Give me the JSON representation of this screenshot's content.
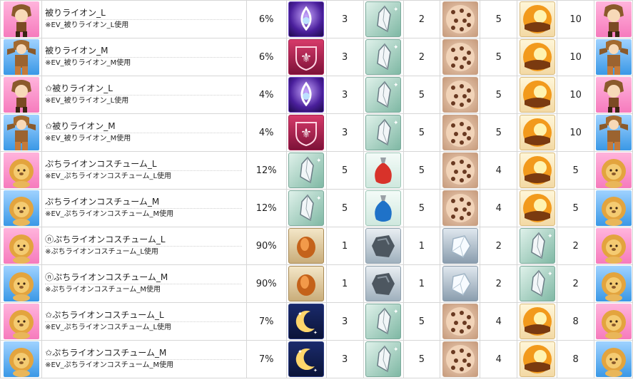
{
  "rows": [
    {
      "name": "被りライオン_L",
      "sub": "※EV_被りライオン_L使用",
      "rate": "6%",
      "avatar": "lion-hood-pink",
      "items": [
        {
          "icon": "purple-drop-orb-icon",
          "qty": "3"
        },
        {
          "icon": "crystal-shard-icon",
          "qty": "2"
        },
        {
          "icon": "leopard-pattern-icon",
          "qty": "5"
        },
        {
          "icon": "sunset-orb-icon",
          "qty": "10"
        }
      ]
    },
    {
      "name": "被りライオン_M",
      "sub": "※EV_被りライオン_M使用",
      "rate": "6%",
      "avatar": "lion-hood-blue",
      "items": [
        {
          "icon": "fleur-de-lis-shield-icon",
          "qty": "3"
        },
        {
          "icon": "crystal-shard-icon",
          "qty": "2"
        },
        {
          "icon": "leopard-pattern-icon",
          "qty": "5"
        },
        {
          "icon": "sunset-orb-icon",
          "qty": "10"
        }
      ]
    },
    {
      "name": "✩被りライオン_L",
      "sub": "※EV_被りライオン_L使用",
      "rate": "4%",
      "avatar": "lion-hood-pink",
      "items": [
        {
          "icon": "purple-drop-orb-icon",
          "qty": "3"
        },
        {
          "icon": "crystal-shard-icon",
          "qty": "5"
        },
        {
          "icon": "leopard-pattern-icon",
          "qty": "5"
        },
        {
          "icon": "sunset-orb-icon",
          "qty": "10"
        }
      ]
    },
    {
      "name": "✩被りライオン_M",
      "sub": "※EV_被りライオン_M使用",
      "rate": "4%",
      "avatar": "lion-hood-blue",
      "items": [
        {
          "icon": "fleur-de-lis-shield-icon",
          "qty": "3"
        },
        {
          "icon": "crystal-shard-icon",
          "qty": "5"
        },
        {
          "icon": "leopard-pattern-icon",
          "qty": "5"
        },
        {
          "icon": "sunset-orb-icon",
          "qty": "10"
        }
      ]
    },
    {
      "name": "ぷちライオンコスチューム_L",
      "sub": "※EV_ぷちライオンコスチューム_L使用",
      "rate": "12%",
      "avatar": "petit-lion-pink",
      "items": [
        {
          "icon": "crystal-shard-icon",
          "qty": "5"
        },
        {
          "icon": "red-pouch-icon",
          "qty": "5"
        },
        {
          "icon": "leopard-pattern-icon",
          "qty": "4"
        },
        {
          "icon": "sunset-orb-icon",
          "qty": "5"
        }
      ]
    },
    {
      "name": "ぷちライオンコスチューム_M",
      "sub": "※EV_ぷちライオンコスチューム_M使用",
      "rate": "12%",
      "avatar": "petit-lion-blue",
      "items": [
        {
          "icon": "crystal-shard-icon",
          "qty": "5"
        },
        {
          "icon": "blue-pouch-icon",
          "qty": "5"
        },
        {
          "icon": "leopard-pattern-icon",
          "qty": "4"
        },
        {
          "icon": "sunset-orb-icon",
          "qty": "5"
        }
      ]
    },
    {
      "name": "ⓝぷちライオンコスチューム_L",
      "sub": "※ぷちライオンコスチューム_L使用",
      "rate": "90%",
      "avatar": "petit-lion-pink",
      "items": [
        {
          "icon": "copper-ore-icon",
          "qty": "1"
        },
        {
          "icon": "grey-stone-icon",
          "qty": "1"
        },
        {
          "icon": "clear-crystal-icon",
          "qty": "2"
        },
        {
          "icon": "crystal-shard-icon",
          "qty": "2"
        }
      ]
    },
    {
      "name": "ⓝぷちライオンコスチューム_M",
      "sub": "※ぷちライオンコスチューム_M使用",
      "rate": "90%",
      "avatar": "petit-lion-blue",
      "items": [
        {
          "icon": "copper-ore-icon",
          "qty": "1"
        },
        {
          "icon": "grey-stone-icon",
          "qty": "1"
        },
        {
          "icon": "clear-crystal-icon",
          "qty": "2"
        },
        {
          "icon": "crystal-shard-icon",
          "qty": "2"
        }
      ]
    },
    {
      "name": "✩ぷちライオンコスチューム_L",
      "sub": "※EV_ぷちライオンコスチューム_L使用",
      "rate": "7%",
      "avatar": "petit-lion-pink",
      "items": [
        {
          "icon": "crescent-moon-icon",
          "qty": "3"
        },
        {
          "icon": "crystal-shard-icon",
          "qty": "5"
        },
        {
          "icon": "leopard-pattern-icon",
          "qty": "4"
        },
        {
          "icon": "sunset-orb-icon",
          "qty": "8"
        }
      ]
    },
    {
      "name": "✩ぷちライオンコスチューム_M",
      "sub": "※EV_ぷちライオンコスチューム_M使用",
      "rate": "7%",
      "avatar": "petit-lion-blue",
      "items": [
        {
          "icon": "crescent-moon-icon",
          "qty": "3"
        },
        {
          "icon": "crystal-shard-icon",
          "qty": "5"
        },
        {
          "icon": "leopard-pattern-icon",
          "qty": "4"
        },
        {
          "icon": "sunset-orb-icon",
          "qty": "8"
        }
      ]
    }
  ]
}
